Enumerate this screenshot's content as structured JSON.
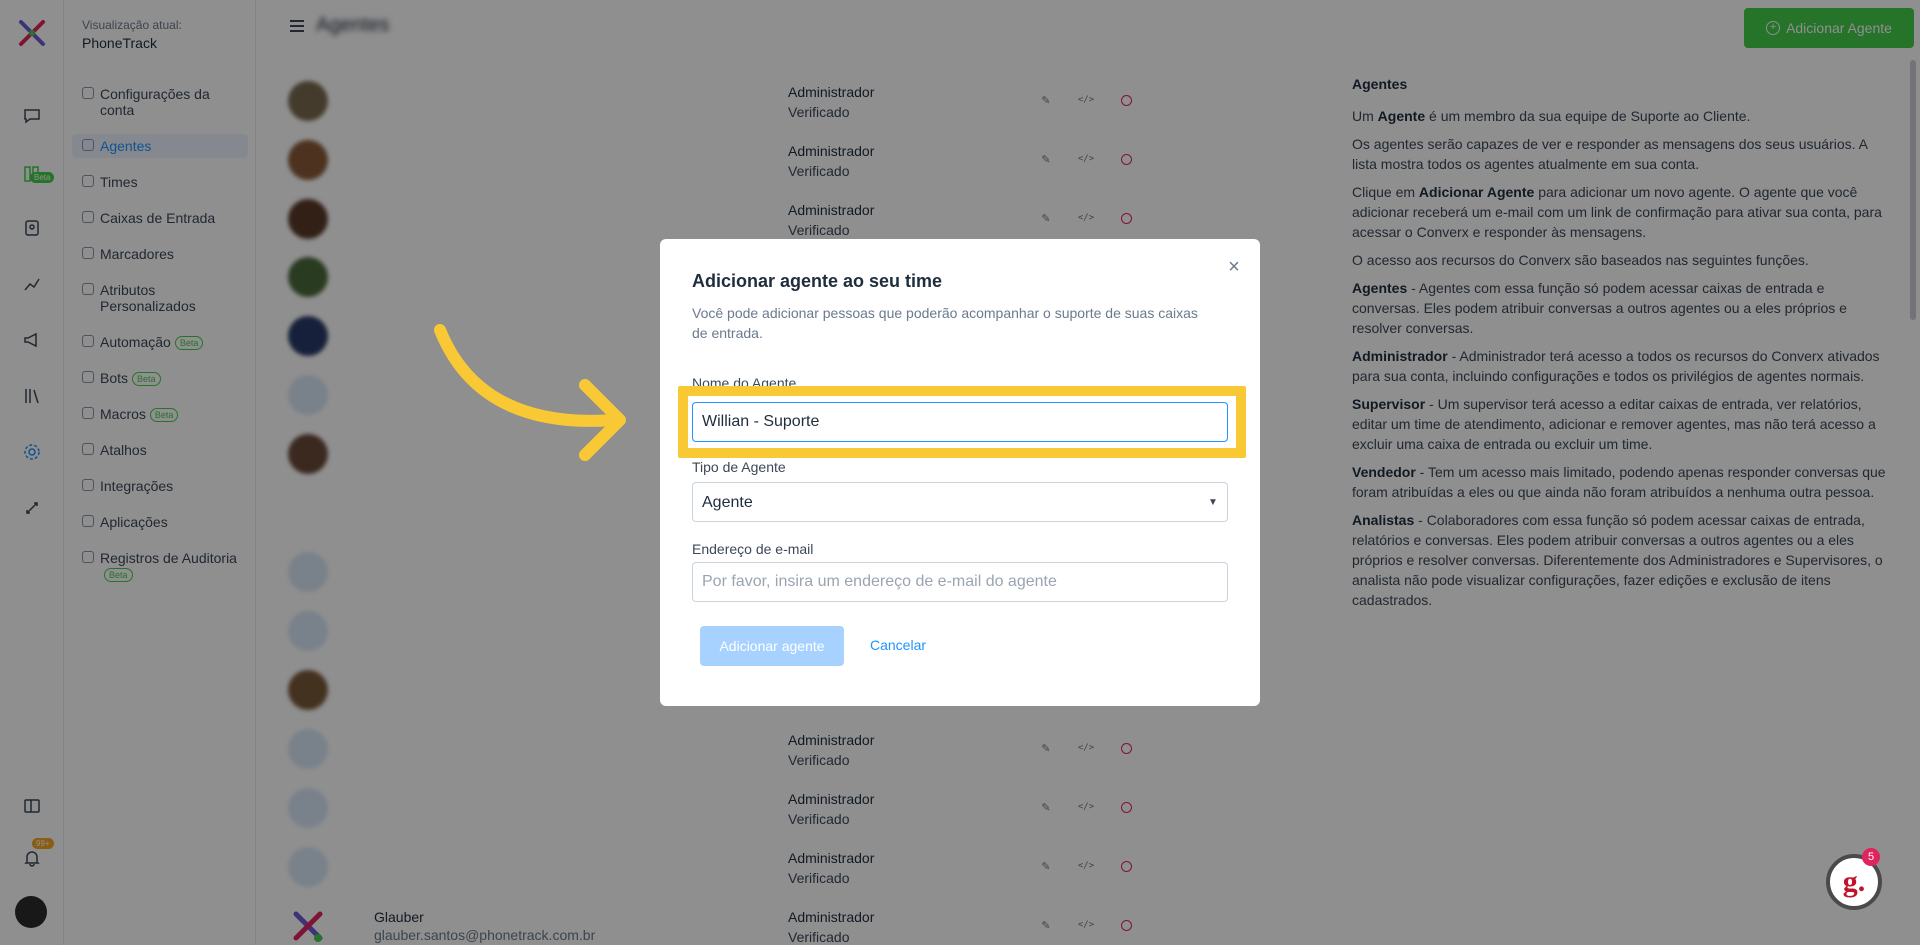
{
  "sidebar": {
    "current_view_label": "Visualização atual:",
    "current_view_value": "PhoneTrack",
    "items": [
      {
        "label": "Configurações da conta",
        "beta": ""
      },
      {
        "label": "Agentes",
        "beta": ""
      },
      {
        "label": "Times",
        "beta": ""
      },
      {
        "label": "Caixas de Entrada",
        "beta": ""
      },
      {
        "label": "Marcadores",
        "beta": ""
      },
      {
        "label": "Atributos Personalizados",
        "beta": ""
      },
      {
        "label": "Automação",
        "beta": "Beta"
      },
      {
        "label": "Bots",
        "beta": "Beta"
      },
      {
        "label": "Macros",
        "beta": "Beta"
      },
      {
        "label": "Atalhos",
        "beta": ""
      },
      {
        "label": "Integrações",
        "beta": ""
      },
      {
        "label": "Aplicações",
        "beta": ""
      },
      {
        "label": "Registros de Auditoria",
        "beta": "Beta"
      }
    ]
  },
  "rail": {
    "beta_badge": "Beta",
    "notifications_badge": "99+"
  },
  "header": {
    "title": "Agentes",
    "add_button": "Adicionar Agente"
  },
  "agents": [
    {
      "name": "",
      "email": "",
      "role": "Administrador",
      "status": "Verificado"
    },
    {
      "name": "",
      "email": "",
      "role": "Administrador",
      "status": "Verificado"
    },
    {
      "name": "",
      "email": "",
      "role": "Administrador",
      "status": "Verificado"
    },
    {
      "name": "",
      "email": "",
      "role": "Administrador",
      "status": "Verificado"
    },
    {
      "name": "",
      "email": "",
      "role": "Administrador",
      "status": "Verificado"
    },
    {
      "name": "Glauber",
      "email": "glauber.santos@phonetrack.com.br",
      "role": "Administrador",
      "status": "Verificado"
    }
  ],
  "help": {
    "title": "Agentes",
    "p1_pre": "Um ",
    "p1_bold": "Agente",
    "p1_post": " é um membro da sua equipe de Suporte ao Cliente.",
    "p2": "Os agentes serão capazes de ver e responder as mensagens dos seus usuários. A lista mostra todos os agentes atualmente em sua conta.",
    "p3_pre": "Clique em ",
    "p3_bold": "Adicionar Agente",
    "p3_post": " para adicionar um novo agente. O agente que você adicionar receberá um e-mail com um link de confirmação para ativar sua conta, para acessar o Converx e responder às mensagens.",
    "p4": "O acesso aos recursos do Converx são baseados nas seguintes funções.",
    "p5_bold": "Agentes",
    "p5_post": " - Agentes com essa função só podem acessar caixas de entrada e conversas. Eles podem atribuir conversas a outros agentes ou a eles próprios e resolver conversas.",
    "p6_bold": "Administrador",
    "p6_post": " - Administrador terá acesso a todos os recursos do Converx ativados para sua conta, incluindo configurações e todos os privilégios de agentes normais.",
    "p7_bold": "Supervisor",
    "p7_post": " - Um supervisor terá acesso a editar caixas de entrada, ver relatórios, editar um time de atendimento, adicionar e remover agentes, mas não terá acesso a excluir uma caixa de entrada ou excluir um time.",
    "p8_bold": "Vendedor",
    "p8_post": " - Tem um acesso mais limitado, podendo apenas responder conversas que foram atribuídas a eles ou que ainda não foram atribuídos a nenhuma outra pessoa.",
    "p9_bold": "Analistas",
    "p9_post": " - Colaboradores com essa função só podem acessar caixas de entrada, relatórios e conversas. Eles podem atribuir conversas a outros agentes ou a eles próprios e resolver conversas. Diferentemente dos Administradores e Supervisores, o analista não pode visualizar configurações, fazer edições e exclusão de itens cadastrados."
  },
  "modal": {
    "title": "Adicionar agente ao seu time",
    "description": "Você pode adicionar pessoas que poderão acompanhar o suporte de suas caixas de entrada.",
    "name_label": "Nome do Agente",
    "name_value": "Willian - Suporte",
    "type_label": "Tipo de Agente",
    "type_value": "Agente",
    "email_label": "Endereço de e-mail",
    "email_placeholder": "Por favor, insira um endereço de e-mail do agente",
    "submit": "Adicionar agente",
    "cancel": "Cancelar"
  },
  "widget": {
    "letter": "g.",
    "badge": "5"
  },
  "colors": {
    "accent": "#1f93ff",
    "success": "#44ce4b",
    "danger": "#e0245e",
    "highlight": "#f9c935"
  }
}
